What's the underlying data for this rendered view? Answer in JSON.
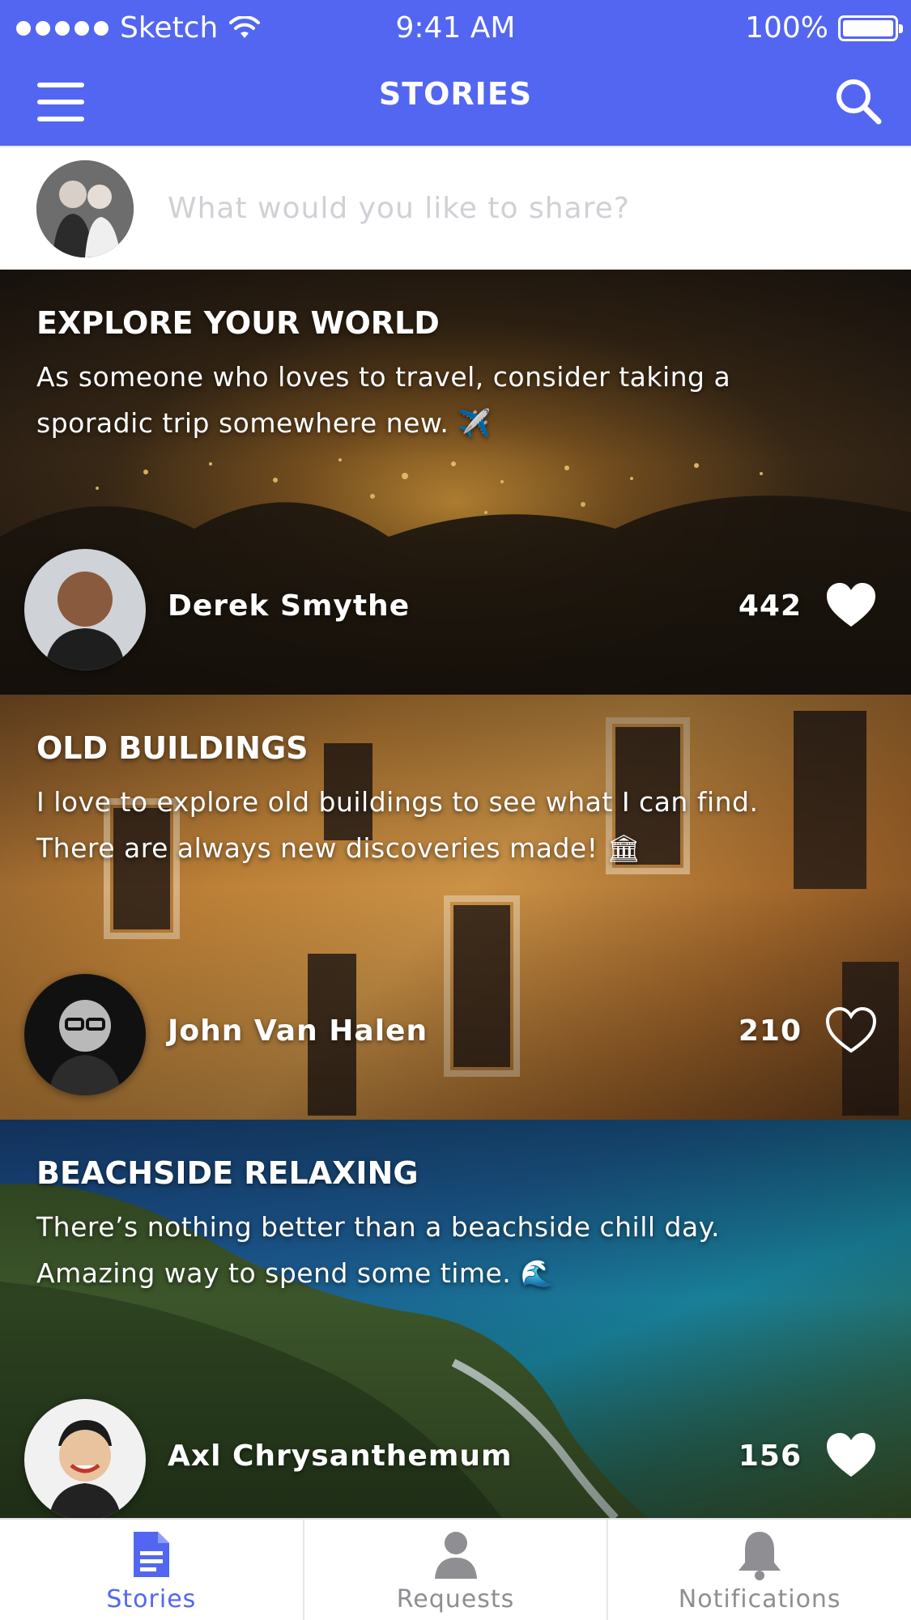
{
  "status_bar": {
    "carrier": "Sketch",
    "time": "9:41 AM",
    "battery": "100%"
  },
  "nav": {
    "title": "STORIES",
    "menu_icon": "hamburger-icon",
    "search_icon": "search-icon"
  },
  "composer": {
    "placeholder": "What would you like to share?"
  },
  "stories": [
    {
      "title": "EXPLORE YOUR WORLD",
      "text": "As someone who loves to travel, consider taking a sporadic trip somewhere new. ✈️",
      "author": "Derek Smythe",
      "likes": "442",
      "liked": true
    },
    {
      "title": "OLD BUILDINGS",
      "text": "I love to explore old buildings to see what I can find. There are always new discoveries made! 🏛",
      "author": "John Van Halen",
      "likes": "210",
      "liked": false
    },
    {
      "title": "BEACHSIDE RELAXING",
      "text": "There’s nothing better than a beachside chill day. Amazing way to spend some time. 🌊",
      "author": "Axl Chrysanthemum",
      "likes": "156",
      "liked": true
    }
  ],
  "tabs": [
    {
      "label": "Stories",
      "icon": "document-icon",
      "active": true
    },
    {
      "label": "Requests",
      "icon": "person-icon",
      "active": false
    },
    {
      "label": "Notifications",
      "icon": "bell-icon",
      "active": false
    }
  ],
  "colors": {
    "accent": "#5366f1",
    "tab_inactive": "#8e8e93"
  }
}
